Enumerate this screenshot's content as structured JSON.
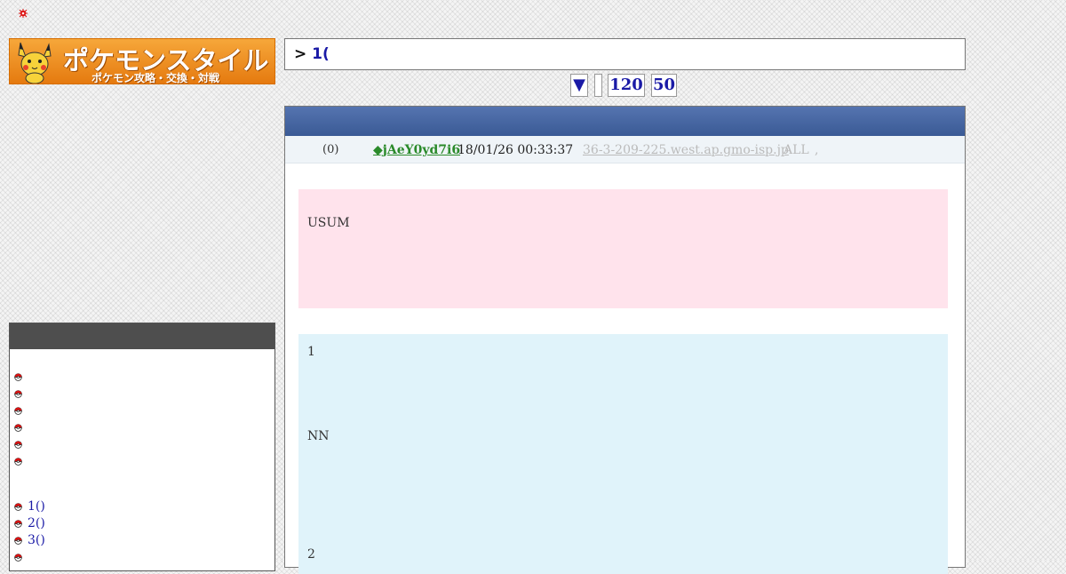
{
  "header": {
    "logo_title": "ポケモンスタイル",
    "logo_subtitle": "ポケモン攻略・交換・対戦"
  },
  "thread": {
    "title_prefix": ">",
    "title_number": "1("
  },
  "nav": {
    "down_arrow": "▼",
    "blank": "",
    "last_120": "120",
    "last_50": "50"
  },
  "post": {
    "count": "(0)",
    "trip": "◆jAeY0yd7i6",
    "date": "18/01/26 00:33:37",
    "host": "36-3-209-225.west.ap.gmo-isp.jp",
    "all": "ALL",
    "comma": ",",
    "pink_text": "USUM",
    "blue_line1": "1",
    "blue_line2": "NN",
    "blue_line3": "2"
  },
  "sidebar": {
    "links": [
      "1()",
      "2()",
      "3()"
    ]
  },
  "colors": {
    "accent": "#1a1aa6",
    "trip": "#2a8a2a",
    "header_bar": "#3a5a95",
    "pink": "#ffe3ec",
    "blue": "#e0f3fa"
  }
}
